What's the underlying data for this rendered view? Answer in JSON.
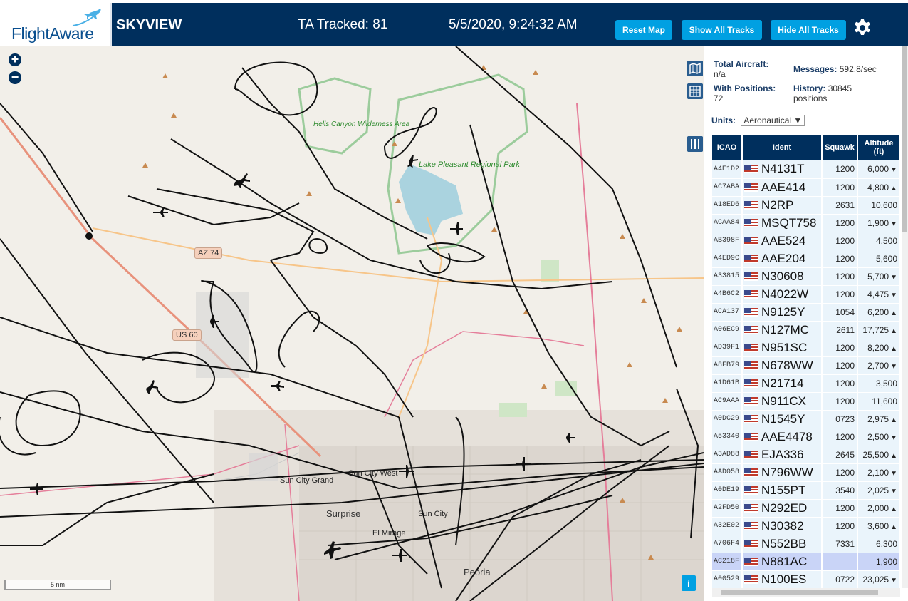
{
  "header": {
    "logo_text": "FlightAware",
    "app_title": "SKYVIEW",
    "ta_tracked": "TA Tracked: 81",
    "clock": "5/5/2020, 9:24:32 AM",
    "buttons": {
      "reset": "Reset Map",
      "show_all": "Show All Tracks",
      "hide_all": "Hide All Tracks"
    }
  },
  "map": {
    "zoom_in": "+",
    "zoom_out": "−",
    "scale_label": "5 nm",
    "info": "i",
    "labels": {
      "hells_canyon": "Hells Canyon Wilderness Area",
      "lake_pleasant": "Lake Pleasant Regional Park",
      "sun_city_grand": "Sun City Grand",
      "sun_city_west": "Sun City West",
      "sun_city": "Sun City",
      "surprise": "Surprise",
      "el_mirage": "El Mirage",
      "peoria": "Peoria",
      "az74": "AZ 74",
      "us60": "US 60"
    }
  },
  "sidebar": {
    "total_aircraft_label": "Total Aircraft:",
    "total_aircraft_value": "n/a",
    "messages_label": "Messages:",
    "messages_value": "592.8/sec",
    "with_positions_label": "With Positions:",
    "with_positions_value": "72",
    "history_label": "History:",
    "history_value": "30845 positions",
    "units_label": "Units:",
    "units_value": "Aeronautical",
    "columns": [
      "ICAO",
      "Ident",
      "Squawk",
      "Altitude (ft)"
    ],
    "rows": [
      {
        "icao": "A4E1D2",
        "ident": "N4131T",
        "squawk": "1200",
        "alt": "6,000",
        "trend": "down"
      },
      {
        "icao": "AC7ABA",
        "ident": "AAE414",
        "squawk": "1200",
        "alt": "4,800",
        "trend": "up"
      },
      {
        "icao": "A18ED6",
        "ident": "N2RP",
        "squawk": "2631",
        "alt": "10,600",
        "trend": ""
      },
      {
        "icao": "ACAA84",
        "ident": "MSQT758",
        "squawk": "1200",
        "alt": "1,900",
        "trend": "down"
      },
      {
        "icao": "AB398F",
        "ident": "AAE524",
        "squawk": "1200",
        "alt": "4,500",
        "trend": ""
      },
      {
        "icao": "A4ED9C",
        "ident": "AAE204",
        "squawk": "1200",
        "alt": "5,600",
        "trend": ""
      },
      {
        "icao": "A33815",
        "ident": "N30608",
        "squawk": "1200",
        "alt": "5,700",
        "trend": "down"
      },
      {
        "icao": "A4B6C2",
        "ident": "N4022W",
        "squawk": "1200",
        "alt": "4,475",
        "trend": "down"
      },
      {
        "icao": "ACA137",
        "ident": "N9125Y",
        "squawk": "1054",
        "alt": "6,200",
        "trend": "up"
      },
      {
        "icao": "A06EC9",
        "ident": "N127MC",
        "squawk": "2611",
        "alt": "17,725",
        "trend": "up"
      },
      {
        "icao": "AD39F1",
        "ident": "N951SC",
        "squawk": "1200",
        "alt": "8,200",
        "trend": "up"
      },
      {
        "icao": "A8FB79",
        "ident": "N678WW",
        "squawk": "1200",
        "alt": "2,700",
        "trend": "down"
      },
      {
        "icao": "A1D61B",
        "ident": "N21714",
        "squawk": "1200",
        "alt": "3,500",
        "trend": ""
      },
      {
        "icao": "AC9AAA",
        "ident": "N911CX",
        "squawk": "1200",
        "alt": "11,600",
        "trend": ""
      },
      {
        "icao": "A0DC29",
        "ident": "N1545Y",
        "squawk": "0723",
        "alt": "2,975",
        "trend": "up"
      },
      {
        "icao": "A53340",
        "ident": "AAE4478",
        "squawk": "1200",
        "alt": "2,500",
        "trend": "down"
      },
      {
        "icao": "A3AD88",
        "ident": "EJA336",
        "squawk": "2645",
        "alt": "25,500",
        "trend": "up"
      },
      {
        "icao": "AAD058",
        "ident": "N796WW",
        "squawk": "1200",
        "alt": "2,100",
        "trend": "down"
      },
      {
        "icao": "A0DE19",
        "ident": "N155PT",
        "squawk": "3540",
        "alt": "2,025",
        "trend": "down"
      },
      {
        "icao": "A2FD50",
        "ident": "N292ED",
        "squawk": "1200",
        "alt": "2,000",
        "trend": "up"
      },
      {
        "icao": "A32E02",
        "ident": "N30382",
        "squawk": "1200",
        "alt": "3,600",
        "trend": "up"
      },
      {
        "icao": "A706F4",
        "ident": "N552BB",
        "squawk": "7331",
        "alt": "6,300",
        "trend": ""
      },
      {
        "icao": "AC218F",
        "ident": "N881AC",
        "squawk": "",
        "alt": "1,900",
        "trend": "",
        "selected": true
      },
      {
        "icao": "A00529",
        "ident": "N100ES",
        "squawk": "0722",
        "alt": "23,025",
        "trend": "down"
      }
    ]
  },
  "colors": {
    "header_bg": "#002f5d",
    "button_bg": "#00a0e2",
    "row_bg": "#eaf4fb",
    "selected_row_bg": "#c9d4f7"
  }
}
